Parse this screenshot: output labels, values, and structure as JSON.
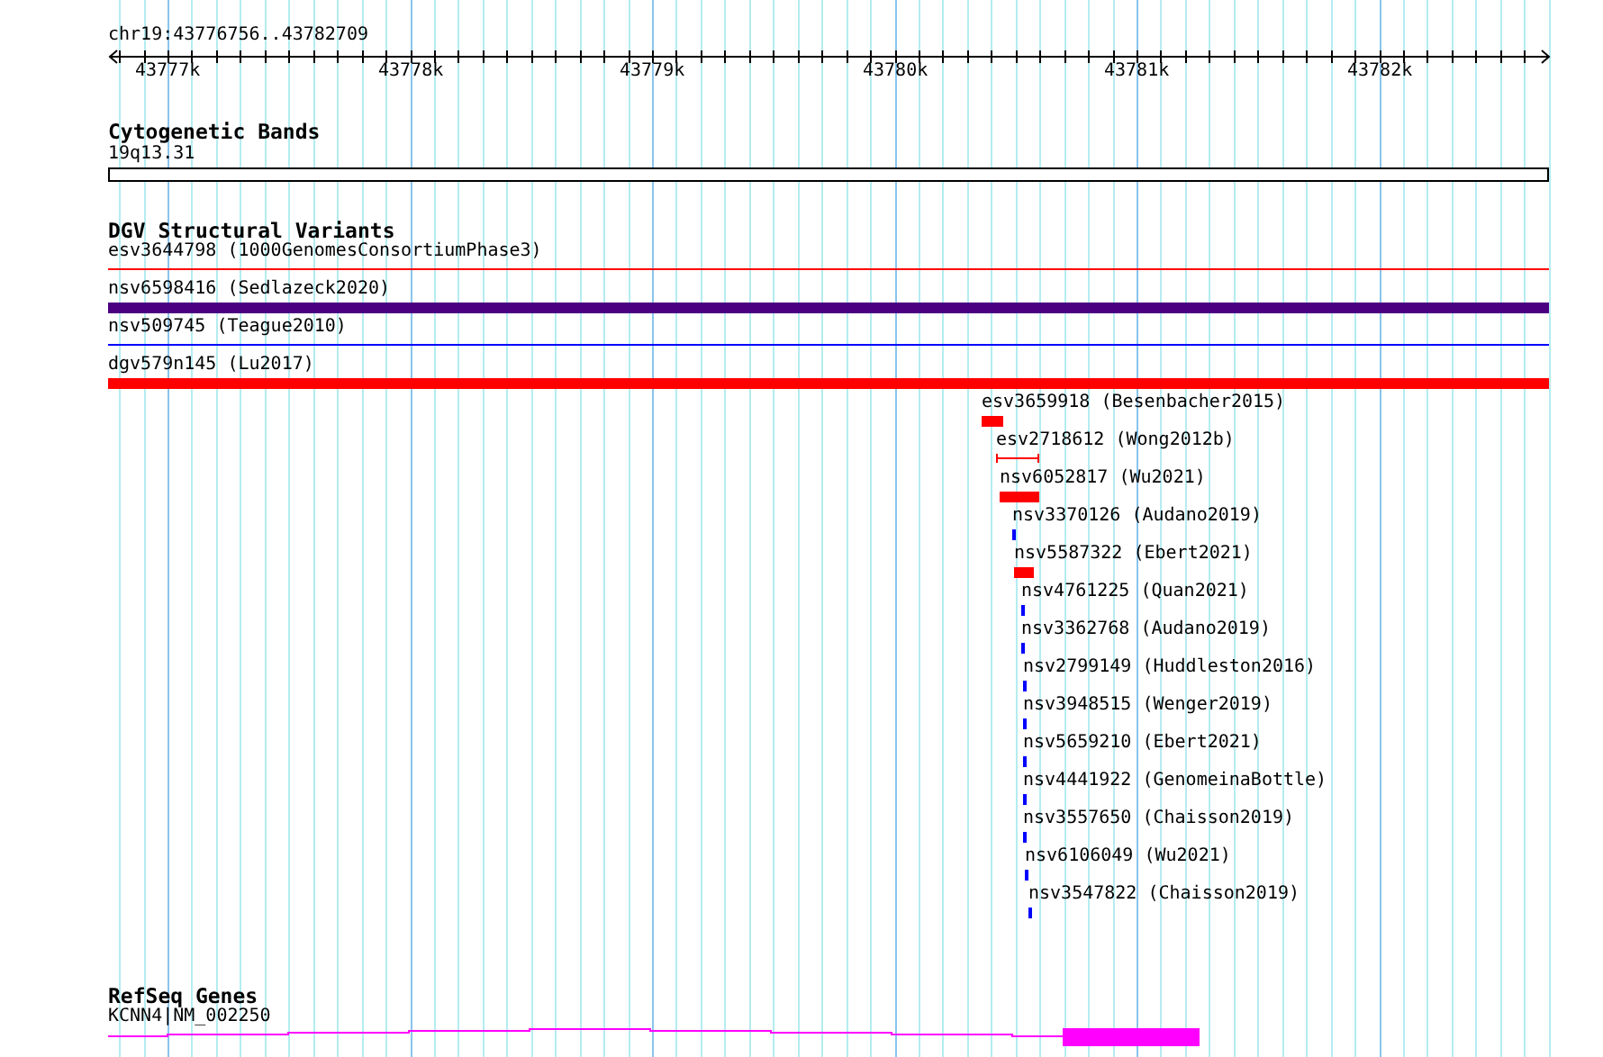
{
  "ruler": {
    "location": "chr19:43776756..43782709",
    "ticks": [
      "43777k",
      "43778k",
      "43779k",
      "43780k",
      "43781k",
      "43782k"
    ]
  },
  "tracks": [
    {
      "kind": "cytoband",
      "title": "Cytogenetic Bands",
      "features": [
        {
          "label": "19q13.31"
        }
      ]
    },
    {
      "kind": "variants",
      "title": "DGV Structural Variants",
      "features": [
        {
          "label": "esv3644798 (1000GenomesConsortiumPhase3)",
          "kind": "line",
          "color": "#ff0000"
        },
        {
          "label": "nsv6598416 (Sedlazeck2020)",
          "kind": "bar",
          "color": "#4b0082"
        },
        {
          "label": "nsv509745 (Teague2010)",
          "kind": "line",
          "color": "#0000ff"
        },
        {
          "label": "dgv579n145 (Lu2017)",
          "kind": "bar",
          "color": "#ff0000"
        },
        {
          "label": "esv3659918 (Besenbacher2015)",
          "kind": "bar",
          "color": "#ff0000"
        },
        {
          "label": "esv2718612 (Wong2012b)",
          "kind": "bracket",
          "color": "#ff0000"
        },
        {
          "label": "nsv6052817 (Wu2021)",
          "kind": "bar",
          "color": "#ff0000"
        },
        {
          "label": "nsv3370126 (Audano2019)",
          "kind": "bar",
          "color": "#0000ff"
        },
        {
          "label": "nsv5587322 (Ebert2021)",
          "kind": "bar",
          "color": "#ff0000"
        },
        {
          "label": "nsv4761225 (Quan2021)",
          "kind": "bar",
          "color": "#0000ff"
        },
        {
          "label": "nsv3362768 (Audano2019)",
          "kind": "bar",
          "color": "#0000ff"
        },
        {
          "label": "nsv2799149 (Huddleston2016)",
          "kind": "bar",
          "color": "#0000ff"
        },
        {
          "label": "nsv3948515 (Wenger2019)",
          "kind": "bar",
          "color": "#0000ff"
        },
        {
          "label": "nsv5659210 (Ebert2021)",
          "kind": "bar",
          "color": "#0000ff"
        },
        {
          "label": "nsv4441922 (GenomeinaBottle)",
          "kind": "bar",
          "color": "#0000ff"
        },
        {
          "label": "nsv3557650 (Chaisson2019)",
          "kind": "bar",
          "color": "#0000ff"
        },
        {
          "label": "nsv6106049 (Wu2021)",
          "kind": "bar",
          "color": "#0000ff"
        },
        {
          "label": "nsv3547822 (Chaisson2019)",
          "kind": "bar",
          "color": "#0000ff"
        }
      ]
    },
    {
      "kind": "genes",
      "title": "RefSeq Genes",
      "features": [
        {
          "label": "KCNN4|NM_002250"
        }
      ]
    }
  ]
}
